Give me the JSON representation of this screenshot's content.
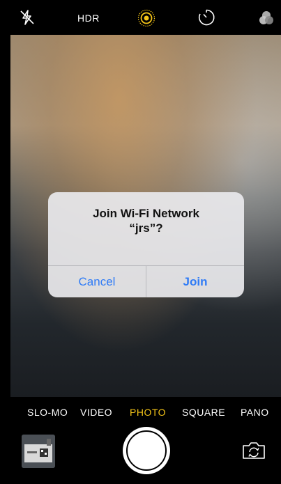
{
  "topbar": {
    "flash_icon": "flash-off-icon",
    "hdr_label": "HDR",
    "live_icon": "live-photo-icon",
    "timer_icon": "timer-icon",
    "filters_icon": "filters-icon"
  },
  "dialog": {
    "title_line1": "Join Wi-Fi Network",
    "title_line2": "“jrs”?",
    "cancel_label": "Cancel",
    "join_label": "Join",
    "accent_color": "#2f7bf6"
  },
  "modes": {
    "items": [
      "SLO-MO",
      "VIDEO",
      "PHOTO",
      "SQUARE",
      "PANO"
    ],
    "selected": "PHOTO",
    "selected_color": "#f5c518"
  },
  "bottom": {
    "thumbnail_icon": "last-photo-thumbnail",
    "shutter_icon": "shutter-button",
    "switch_icon": "camera-switch-icon"
  }
}
